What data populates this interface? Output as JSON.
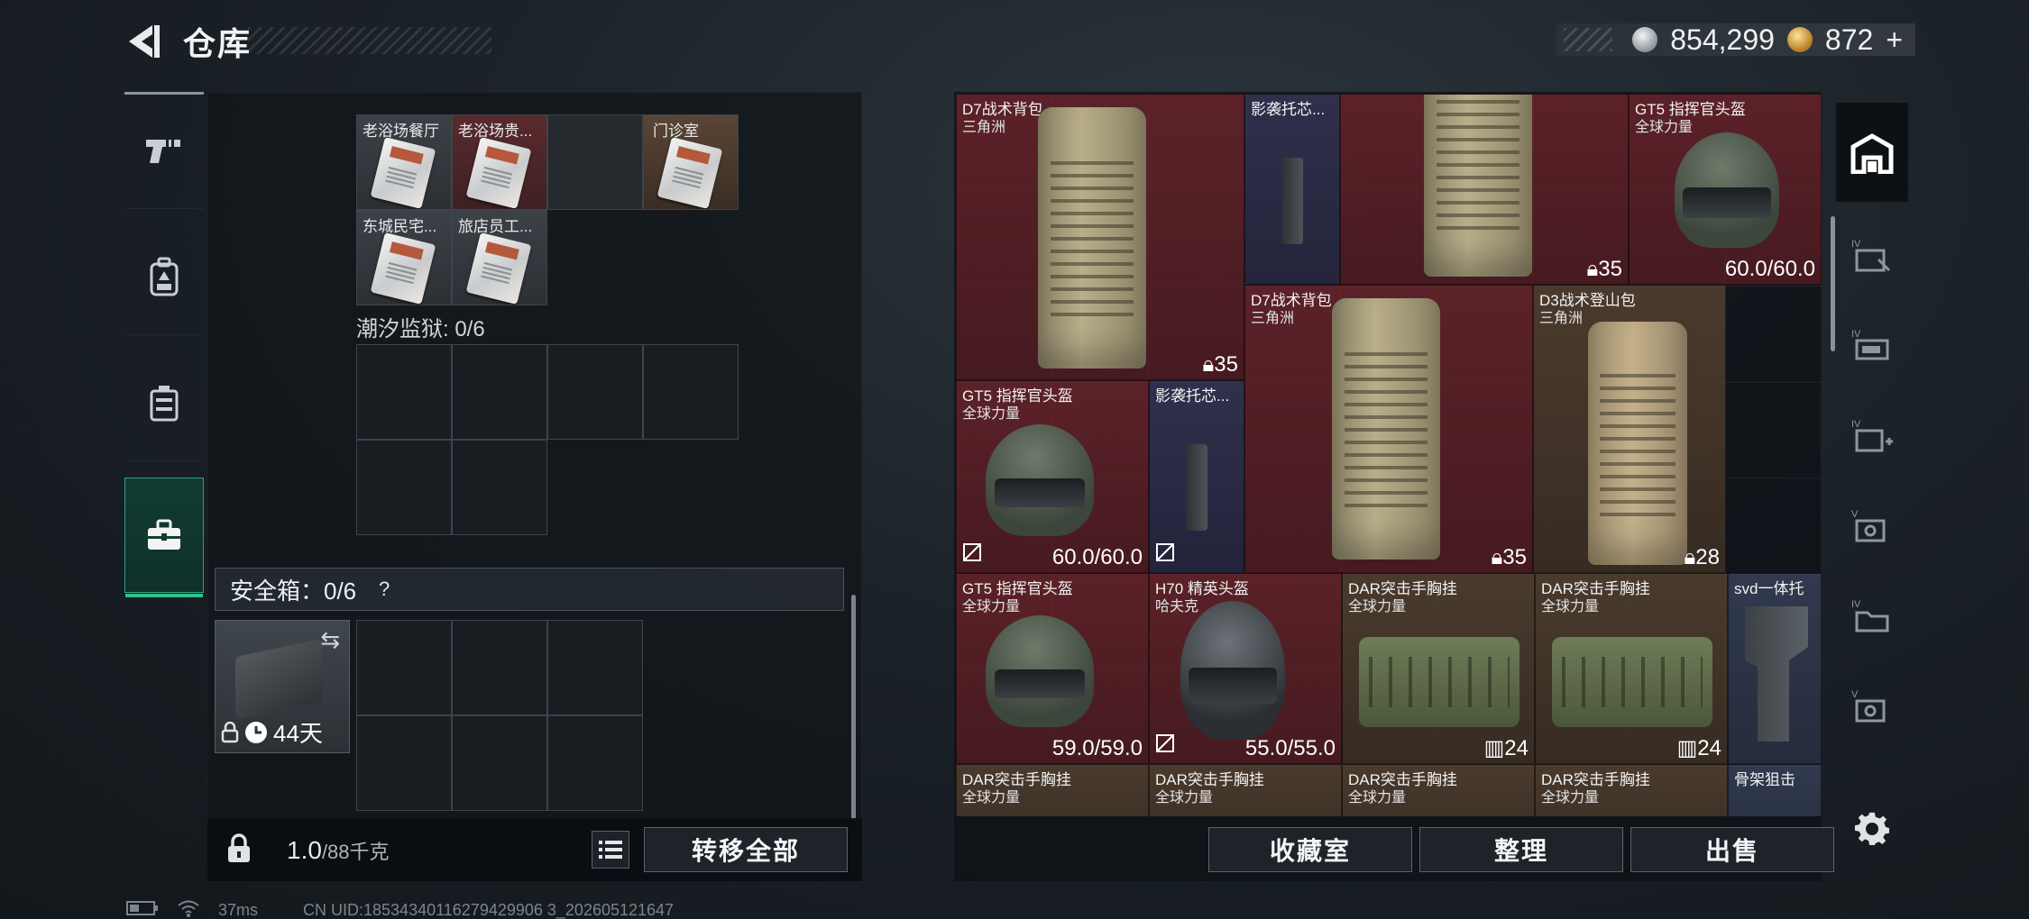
{
  "header": {
    "title": "仓库",
    "silver_amount": "854,299",
    "gold_amount": "872",
    "gold_plus": "+"
  },
  "left_nav": {
    "items": [
      {
        "name": "weapons-tab",
        "icon": "pistol-icon"
      },
      {
        "name": "equipment-tab",
        "icon": "backpack-icon"
      },
      {
        "name": "containers-tab",
        "icon": "case-icon"
      },
      {
        "name": "toolbox-tab",
        "icon": "toolbox-icon",
        "active": true
      }
    ]
  },
  "left_panel": {
    "keycards": [
      {
        "label": "老浴场餐厅",
        "color": "gray"
      },
      {
        "label": "老浴场贵...",
        "color": "red"
      },
      {
        "label": "",
        "color": "empty"
      },
      {
        "label": "门诊室",
        "color": "brown"
      },
      {
        "label": "东城民宅...",
        "color": "gray"
      },
      {
        "label": "旅店员工...",
        "color": "gray"
      }
    ],
    "prison_label": "潮汐监狱: 0/6",
    "safebox_label": "安全箱：0/6",
    "safebox_help": "?",
    "safecase_days": "44天",
    "weight_value": "1.0",
    "weight_unit": "/88千克",
    "transfer_all": "转移全部"
  },
  "inventory": {
    "items": [
      {
        "name": "D7战术背包",
        "sub": "三角洲",
        "stat": "35",
        "stat_icon": "backpack-capacity-icon"
      },
      {
        "name": "影袭托芯...",
        "sub": "",
        "stat": ""
      },
      {
        "name": "",
        "sub": "",
        "stat": "35"
      },
      {
        "name": "GT5 指挥官头盔",
        "sub": "全球力量",
        "stat": "60.0/60.0"
      },
      {
        "name": "D7战术背包",
        "sub": "三角洲",
        "stat": "35"
      },
      {
        "name": "D3战术登山包",
        "sub": "三角洲",
        "stat": "28"
      },
      {
        "name": "GT5 指挥官头盔",
        "sub": "全球力量",
        "stat": "60.0/60.0"
      },
      {
        "name": "影袭托芯...",
        "sub": "",
        "stat": ""
      },
      {
        "name": "GT5 指挥官头盔",
        "sub": "全球力量",
        "stat": "59.0/59.0"
      },
      {
        "name": "H70 精英头盔",
        "sub": "哈夫克",
        "stat": "55.0/55.0"
      },
      {
        "name": "DAR突击手胸挂",
        "sub": "全球力量",
        "stat": "24"
      },
      {
        "name": "DAR突击手胸挂",
        "sub": "全球力量",
        "stat": "24"
      },
      {
        "name": "svd一体托",
        "sub": "",
        "stat": ""
      },
      {
        "name": "DAR突击手胸挂",
        "sub": "全球力量",
        "stat": ""
      },
      {
        "name": "DAR突击手胸挂",
        "sub": "全球力量",
        "stat": ""
      },
      {
        "name": "DAR突击手胸挂",
        "sub": "全球力量",
        "stat": ""
      },
      {
        "name": "DAR突击手胸挂",
        "sub": "全球力量",
        "stat": ""
      },
      {
        "name": "骨架狙击",
        "sub": "",
        "stat": ""
      }
    ]
  },
  "bottom_buttons": {
    "collection": "收藏室",
    "organize": "整理",
    "sell": "出售"
  },
  "status_bar": {
    "ping": "37ms",
    "uid": "CN UID:18534340116279429906 3_202605121647"
  }
}
